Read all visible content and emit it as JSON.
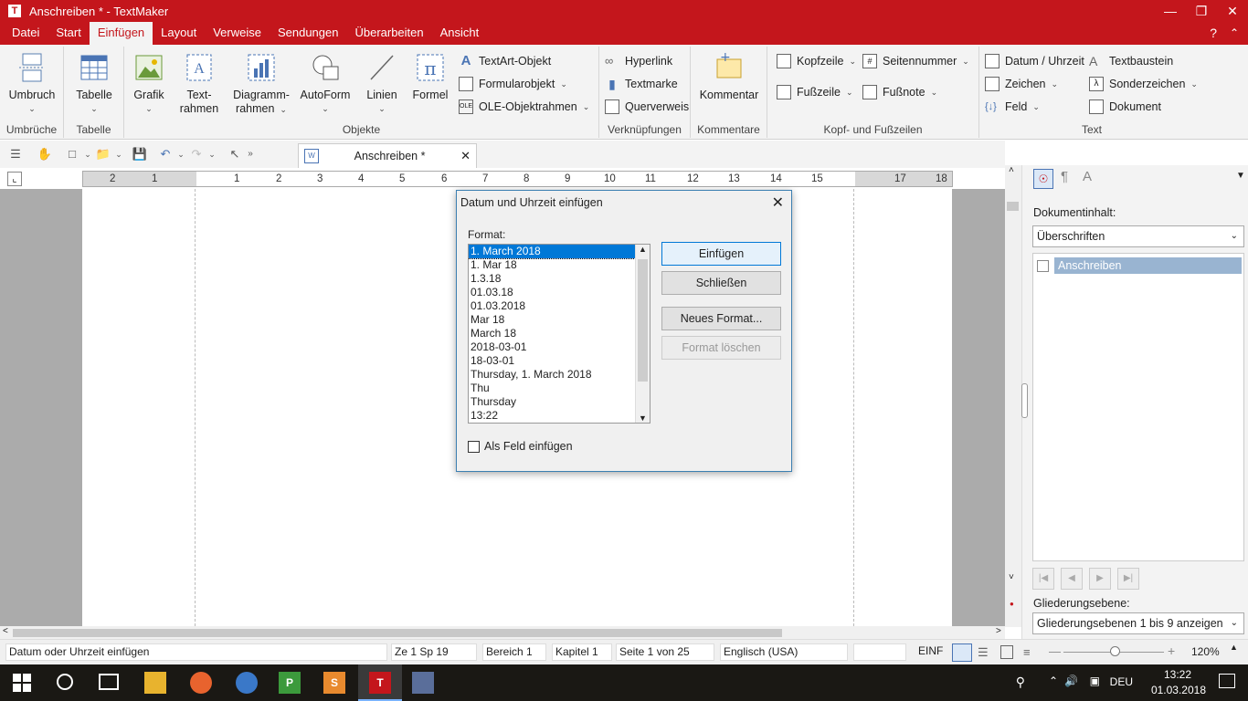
{
  "window": {
    "title": "Anschreiben * - TextMaker",
    "app_icon": "T"
  },
  "menu": {
    "items": [
      "Datei",
      "Start",
      "Einfügen",
      "Layout",
      "Verweise",
      "Sendungen",
      "Überarbeiten",
      "Ansicht"
    ],
    "help": "?"
  },
  "ribbon": {
    "groups": {
      "umbrueche": "Umbrüche",
      "tabelle": "Tabelle",
      "objekte": "Objekte",
      "verknuepfungen": "Verknüpfungen",
      "kommentare": "Kommentare",
      "kopf": "Kopf- und Fußzeilen",
      "text": "Text"
    },
    "umbruch": "Umbruch",
    "tabelle": "Tabelle",
    "grafik": "Grafik",
    "textrahmen_1": "Text-",
    "textrahmen_2": "rahmen",
    "diagramm_1": "Diagramm-",
    "diagramm_2": "rahmen",
    "autoform": "AutoForm",
    "linien": "Linien",
    "formel": "Formel",
    "textart": "TextArt-Objekt",
    "formularobjekt": "Formularobjekt",
    "ole": "OLE-Objektrahmen",
    "hyperlink": "Hyperlink",
    "textmarke": "Textmarke",
    "querverweis": "Querverweis",
    "kommentar": "Kommentar",
    "kopfzeile": "Kopfzeile",
    "fusszeile": "Fußzeile",
    "seitennummer": "Seitennummer",
    "fussnote": "Fußnote",
    "datum": "Datum / Uhrzeit",
    "zeichen": "Zeichen",
    "feld": "Feld",
    "textbaustein": "Textbaustein",
    "sonderzeichen": "Sonderzeichen",
    "dokument": "Dokument"
  },
  "doc_tab": {
    "label": "Anschreiben *"
  },
  "ruler": {
    "ticks": [
      "2",
      "1",
      "1",
      "2",
      "3",
      "4",
      "5",
      "6",
      "7",
      "8",
      "9",
      "10",
      "11",
      "12",
      "13",
      "14",
      "15",
      "17",
      "18"
    ]
  },
  "dialog": {
    "title": "Datum und Uhrzeit einfügen",
    "format_label": "Format:",
    "formats": [
      "1. March 2018",
      "1. Mar 18",
      "1.3.18",
      "01.03.18",
      "01.03.2018",
      "Mar 18",
      "March 18",
      "2018-03-01",
      "18-03-01",
      "Thursday, 1. March 2018",
      "Thu",
      "Thursday",
      "13:22"
    ],
    "selected_index": 0,
    "insert_btn": "Einfügen",
    "close_btn": "Schließen",
    "new_format_btn": "Neues Format...",
    "delete_format_btn": "Format löschen",
    "as_field": "Als Feld einfügen"
  },
  "sidebar": {
    "content_label": "Dokumentinhalt:",
    "content_select": "Überschriften",
    "outline_item": "Anschreiben",
    "level_label": "Gliederungsebene:",
    "level_select": "Gliederungsebenen 1 bis 9 anzeigen"
  },
  "status": {
    "message": "Datum oder Uhrzeit einfügen",
    "position": "Ze 1 Sp 19",
    "bereich": "Bereich 1",
    "kapitel": "Kapitel 1",
    "seite": "Seite 1 von 25",
    "sprache": "Englisch (USA)",
    "mode": "EINF",
    "zoom": "120%"
  },
  "taskbar": {
    "lang": "DEU",
    "time": "13:22",
    "date": "01.03.2018"
  },
  "colors": {
    "brand": "#c4161c",
    "accent": "#0078d7"
  }
}
